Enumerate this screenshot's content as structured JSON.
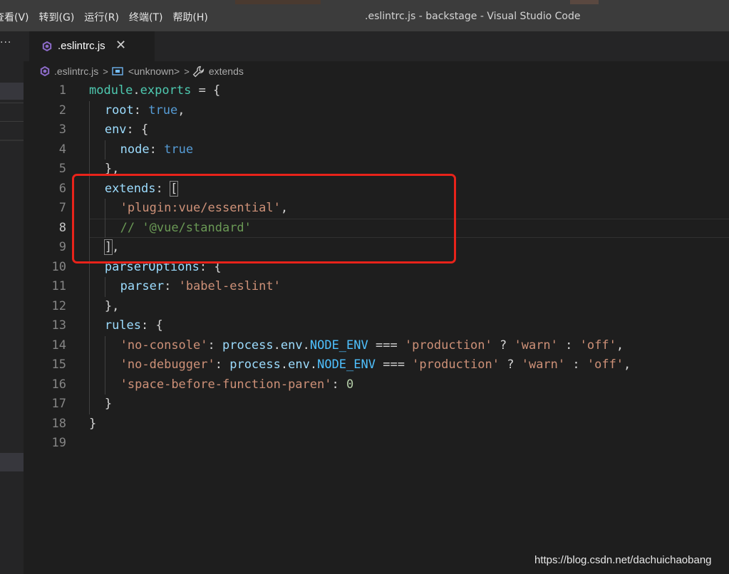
{
  "menu": [
    "查看(V)",
    "转到(G)",
    "运行(R)",
    "终端(T)",
    "帮助(H)"
  ],
  "window_title": ".eslintrc.js - backstage - Visual Studio Code",
  "sidebar": {
    "more": "···"
  },
  "tab": {
    "label": ".eslintrc.js",
    "close": "✕"
  },
  "breadcrumb": {
    "file": ".eslintrc.js",
    "unknown": "<unknown>",
    "symbol": "extends"
  },
  "editor": {
    "active_line": 8,
    "lines": [
      {
        "n": 1,
        "indent": 0,
        "tokens": [
          [
            "var",
            "module"
          ],
          [
            "pun",
            "."
          ],
          [
            "var",
            "exports"
          ],
          [
            "pun",
            " = {"
          ]
        ]
      },
      {
        "n": 2,
        "indent": 1,
        "tokens": [
          [
            "prop",
            "root"
          ],
          [
            "pun",
            ": "
          ],
          [
            "kw",
            "true"
          ],
          [
            "pun",
            ","
          ]
        ]
      },
      {
        "n": 3,
        "indent": 1,
        "tokens": [
          [
            "prop",
            "env"
          ],
          [
            "pun",
            ": {"
          ]
        ]
      },
      {
        "n": 4,
        "indent": 2,
        "tokens": [
          [
            "prop",
            "node"
          ],
          [
            "pun",
            ": "
          ],
          [
            "kw",
            "true"
          ]
        ]
      },
      {
        "n": 5,
        "indent": 1,
        "tokens": [
          [
            "pun",
            "},"
          ]
        ]
      },
      {
        "n": 6,
        "indent": 1,
        "tokens": [
          [
            "prop",
            "extends"
          ],
          [
            "pun",
            ": "
          ],
          [
            "bracket",
            "["
          ]
        ]
      },
      {
        "n": 7,
        "indent": 2,
        "tokens": [
          [
            "str",
            "'plugin:vue/essential'"
          ],
          [
            "pun",
            ","
          ]
        ]
      },
      {
        "n": 8,
        "indent": 2,
        "tokens": [
          [
            "cmt",
            "// '@vue/standard'"
          ]
        ]
      },
      {
        "n": 9,
        "indent": 1,
        "tokens": [
          [
            "bracket",
            "]"
          ],
          [
            "pun",
            ","
          ]
        ]
      },
      {
        "n": 10,
        "indent": 1,
        "tokens": [
          [
            "prop",
            "parserOptions"
          ],
          [
            "pun",
            ": {"
          ]
        ]
      },
      {
        "n": 11,
        "indent": 2,
        "tokens": [
          [
            "prop",
            "parser"
          ],
          [
            "pun",
            ": "
          ],
          [
            "str",
            "'babel-eslint'"
          ]
        ]
      },
      {
        "n": 12,
        "indent": 1,
        "tokens": [
          [
            "pun",
            "},"
          ]
        ]
      },
      {
        "n": 13,
        "indent": 1,
        "tokens": [
          [
            "prop",
            "rules"
          ],
          [
            "pun",
            ": {"
          ]
        ]
      },
      {
        "n": 14,
        "indent": 2,
        "tokens": [
          [
            "str",
            "'no-console'"
          ],
          [
            "pun",
            ": "
          ],
          [
            "vardef",
            "process"
          ],
          [
            "pun",
            "."
          ],
          [
            "vardef",
            "env"
          ],
          [
            "pun",
            "."
          ],
          [
            "const",
            "NODE_ENV"
          ],
          [
            "pun",
            " === "
          ],
          [
            "str",
            "'production'"
          ],
          [
            "pun",
            " ? "
          ],
          [
            "str",
            "'warn'"
          ],
          [
            "pun",
            " : "
          ],
          [
            "str",
            "'off'"
          ],
          [
            "pun",
            ","
          ]
        ]
      },
      {
        "n": 15,
        "indent": 2,
        "tokens": [
          [
            "str",
            "'no-debugger'"
          ],
          [
            "pun",
            ": "
          ],
          [
            "vardef",
            "process"
          ],
          [
            "pun",
            "."
          ],
          [
            "vardef",
            "env"
          ],
          [
            "pun",
            "."
          ],
          [
            "const",
            "NODE_ENV"
          ],
          [
            "pun",
            " === "
          ],
          [
            "str",
            "'production'"
          ],
          [
            "pun",
            " ? "
          ],
          [
            "str",
            "'warn'"
          ],
          [
            "pun",
            " : "
          ],
          [
            "str",
            "'off'"
          ],
          [
            "pun",
            ","
          ]
        ]
      },
      {
        "n": 16,
        "indent": 2,
        "tokens": [
          [
            "str",
            "'space-before-function-paren'"
          ],
          [
            "pun",
            ": "
          ],
          [
            "num",
            "0"
          ]
        ]
      },
      {
        "n": 17,
        "indent": 1,
        "tokens": [
          [
            "pun",
            "}"
          ]
        ]
      },
      {
        "n": 18,
        "indent": 0,
        "tokens": [
          [
            "pun",
            "}"
          ]
        ]
      },
      {
        "n": 19,
        "indent": 0,
        "tokens": []
      }
    ]
  },
  "annotation": {
    "color": "#e8231a"
  },
  "watermark": "https://blog.csdn.net/dachuichaobang",
  "colors": {
    "background": "#1e1e1e",
    "titlebar": "#3c3c3c",
    "sidebar": "#252526",
    "string": "#ce9178",
    "keyword": "#569cd6",
    "property": "#9cdcfe",
    "comment": "#6a9955"
  }
}
